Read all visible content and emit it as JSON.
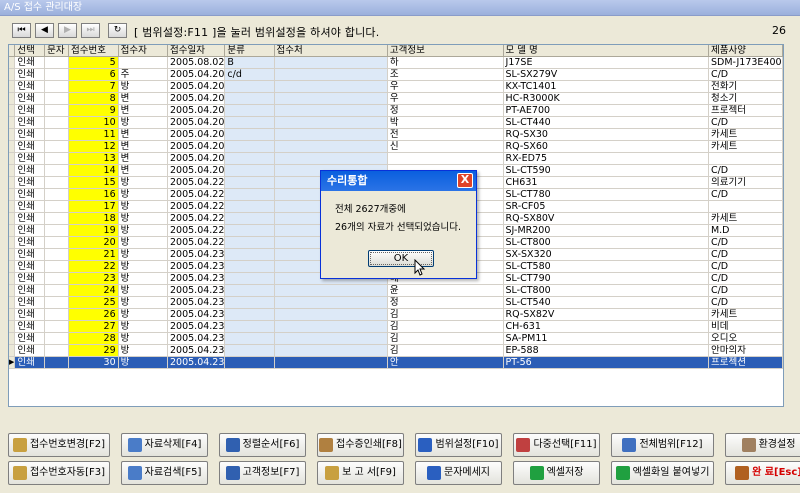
{
  "window": {
    "title": "A/S 접수 관리대장"
  },
  "toolbar": {
    "nav": [
      "⏮",
      "◀",
      "▶",
      "⏭",
      "↻"
    ],
    "message": "[ 범위설정:F11 ]을 눌러 범위설정을 하셔야 합니다.",
    "count": "26"
  },
  "grid": {
    "headers": [
      "선택",
      "문자",
      "접수번호",
      "접수자",
      "접수일자",
      "분류",
      "접수처",
      "고객정보",
      "모 델 명",
      "제품사양"
    ],
    "rows": [
      [
        "인쇄",
        "",
        "5",
        "",
        "2005.08.02",
        "B",
        "",
        "하",
        "J17SE",
        "SDM-J173E400"
      ],
      [
        "인쇄",
        "",
        "6",
        "주",
        "2005.04.20",
        "c/d",
        "",
        "조",
        "SL-SX279V",
        "C/D"
      ],
      [
        "인쇄",
        "",
        "7",
        "방",
        "2005.04.20",
        "",
        "",
        "우",
        "KX-TC1401",
        "전화기"
      ],
      [
        "인쇄",
        "",
        "8",
        "변",
        "2005.04.20",
        "",
        "",
        "우",
        "HC-R3000K",
        "청소기"
      ],
      [
        "인쇄",
        "",
        "9",
        "변",
        "2005.04.20",
        "",
        "",
        "정",
        "PT-AE700",
        "프로젝터"
      ],
      [
        "인쇄",
        "",
        "10",
        "방",
        "2005.04.20",
        "",
        "",
        "박",
        "SL-CT440",
        "C/D"
      ],
      [
        "인쇄",
        "",
        "11",
        "변",
        "2005.04.20",
        "",
        "",
        "전",
        "RQ-SX30",
        "카세트"
      ],
      [
        "인쇄",
        "",
        "12",
        "변",
        "2005.04.20",
        "",
        "",
        "신",
        "RQ-SX60",
        "카세트"
      ],
      [
        "인쇄",
        "",
        "13",
        "변",
        "2005.04.20",
        "",
        "",
        "",
        "RX-ED75",
        ""
      ],
      [
        "인쇄",
        "",
        "14",
        "변",
        "2005.04.20",
        "",
        "",
        "",
        "SL-CT590",
        "C/D"
      ],
      [
        "인쇄",
        "",
        "15",
        "방",
        "2005.04.22",
        "",
        "",
        "",
        "CH631",
        "의료기기"
      ],
      [
        "인쇄",
        "",
        "16",
        "방",
        "2005.04.22",
        "",
        "",
        "",
        "SL-CT780",
        "C/D"
      ],
      [
        "인쇄",
        "",
        "17",
        "방",
        "2005.04.22",
        "",
        "",
        "",
        "SR-CF05",
        ""
      ],
      [
        "인쇄",
        "",
        "18",
        "방",
        "2005.04.22",
        "",
        "",
        "",
        "RQ-SX80V",
        "카세트"
      ],
      [
        "인쇄",
        "",
        "19",
        "방",
        "2005.04.22",
        "",
        "",
        "",
        "SJ-MR200",
        "M.D"
      ],
      [
        "인쇄",
        "",
        "20",
        "방",
        "2005.04.22",
        "",
        "",
        "",
        "SL-CT800",
        "C/D"
      ],
      [
        "인쇄",
        "",
        "21",
        "방",
        "2005.04.23",
        "",
        "",
        "이윤유",
        "SX-SX320",
        "C/D"
      ],
      [
        "인쇄",
        "",
        "22",
        "방",
        "2005.04.23",
        "",
        "",
        "허",
        "SL-CT580",
        "C/D"
      ],
      [
        "인쇄",
        "",
        "23",
        "방",
        "2005.04.23",
        "",
        "",
        "배",
        "SL-CT790",
        "C/D"
      ],
      [
        "인쇄",
        "",
        "24",
        "방",
        "2005.04.23",
        "",
        "",
        "윤",
        "SL-CT800",
        "C/D"
      ],
      [
        "인쇄",
        "",
        "25",
        "방",
        "2005.04.23",
        "",
        "",
        "정",
        "SL-CT540",
        "C/D"
      ],
      [
        "인쇄",
        "",
        "26",
        "방",
        "2005.04.23",
        "",
        "",
        "김",
        "RQ-SX82V",
        "카세트"
      ],
      [
        "인쇄",
        "",
        "27",
        "방",
        "2005.04.23",
        "",
        "",
        "김",
        "CH-631",
        "비데"
      ],
      [
        "인쇄",
        "",
        "28",
        "방",
        "2005.04.23",
        "",
        "",
        "김",
        "SA-PM11",
        "오디오"
      ],
      [
        "인쇄",
        "",
        "29",
        "방",
        "2005.04.23",
        "",
        "",
        "김",
        "EP-588",
        "안마의자"
      ],
      [
        "인쇄",
        "",
        "30",
        "방",
        "2005.04.23",
        "",
        "",
        "안",
        "PT-56",
        "프로젝션"
      ]
    ]
  },
  "dialog": {
    "title": "수리통합",
    "close": "X",
    "line1": "전체 2627개중에",
    "line2": "26개의 자료가 선택되었습니다.",
    "ok": "OK"
  },
  "buttons": {
    "row1": [
      {
        "label": "접수번호변경[F2]",
        "icon": "key-icon",
        "color": "#c8a040"
      },
      {
        "label": "자료삭제[F4]",
        "icon": "delete-icon",
        "color": "#4a7cc8"
      },
      {
        "label": "정렬순서[F6]",
        "icon": "sort-icon",
        "color": "#3060b0"
      },
      {
        "label": "접수증인쇄[F8]",
        "icon": "print-icon",
        "color": "#b08040"
      },
      {
        "label": "범위설정[F10]",
        "icon": "range-icon",
        "color": "#2a5fc0"
      },
      {
        "label": "다중선택[F11]",
        "icon": "multiselect-icon",
        "color": "#c04040"
      },
      {
        "label": "전체범위[F12]",
        "icon": "all-range-icon",
        "color": "#4070c0"
      },
      {
        "label": "환경설정",
        "icon": "settings-icon",
        "color": "#a08060"
      }
    ],
    "row2": [
      {
        "label": "접수번호자동[F3]",
        "icon": "key-icon",
        "color": "#c8a040"
      },
      {
        "label": "자료검색[F5]",
        "icon": "search-icon",
        "color": "#4a7cc8"
      },
      {
        "label": "고객정보[F7]",
        "icon": "customer-icon",
        "color": "#3060b0"
      },
      {
        "label": "보 고 서[F9]",
        "icon": "report-icon",
        "color": "#c8a040"
      },
      {
        "label": "문자메세지",
        "icon": "message-icon",
        "color": "#2a5fc0"
      },
      {
        "label": "엑셀저장",
        "icon": "excel-icon",
        "color": "#20a040"
      },
      {
        "label": "엑셀화일 붙여넣기",
        "icon": "excel-paste-icon",
        "color": "#20a040"
      },
      {
        "label": "완 료[Esc]",
        "icon": "exit-icon",
        "color": "#b06020"
      }
    ]
  }
}
